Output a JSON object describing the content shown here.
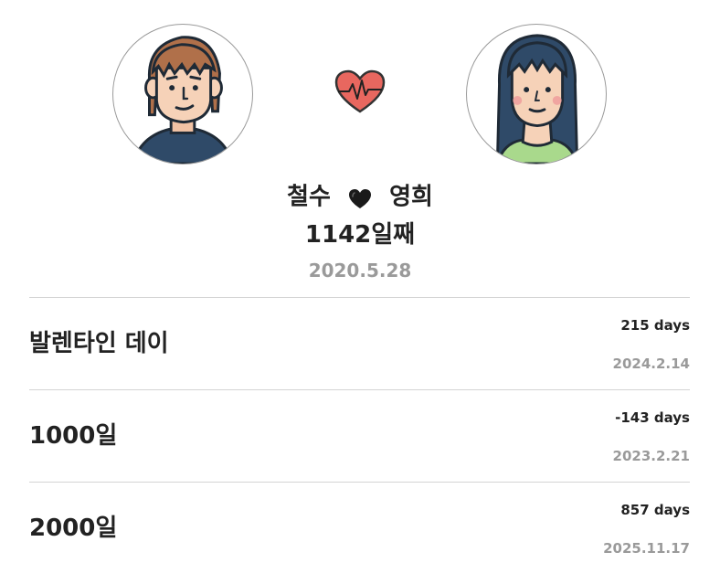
{
  "couple": {
    "left_avatar": "boy-avatar",
    "right_avatar": "girl-avatar",
    "center_icon": "heartbeat-heart-icon",
    "name_left": "철수",
    "name_right": "영희",
    "separator_icon": "black-heart-icon",
    "dday_label": "1142일째",
    "start_date": "2020.5.28"
  },
  "colors": {
    "heart_red": "#e8675f",
    "muted_text": "#9a9a9a",
    "divider": "#d4d4d4",
    "text": "#222222"
  },
  "events": [
    {
      "name": "발렌타인 데이",
      "days": "215 days",
      "date": "2024.2.14"
    },
    {
      "name": "1000일",
      "days": "-143 days",
      "date": "2023.2.21"
    },
    {
      "name": "2000일",
      "days": "857 days",
      "date": "2025.11.17"
    }
  ]
}
